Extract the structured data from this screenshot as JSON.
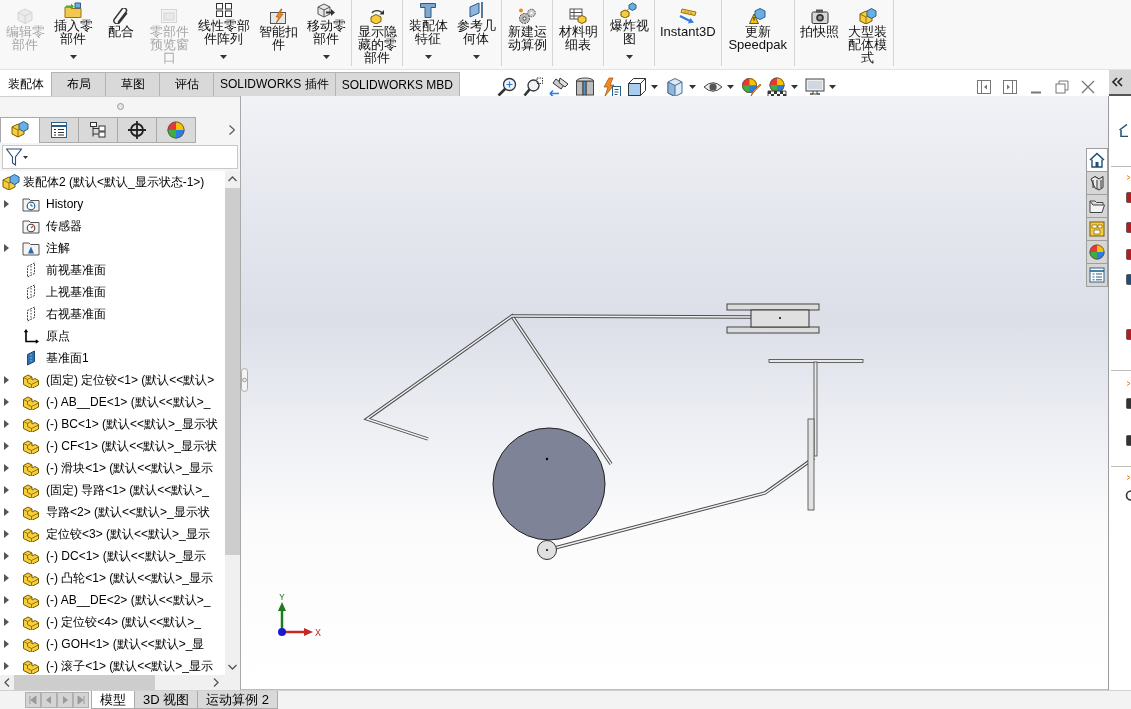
{
  "ribbon": {
    "groups": [
      {
        "buttons": [
          {
            "kind": "edit-component",
            "label": "编辑零部件",
            "disabled": true,
            "dropdown": false
          },
          {
            "kind": "insert-component",
            "label": "插入零部件",
            "disabled": false,
            "dropdown": true
          },
          {
            "kind": "mate",
            "label": "配合",
            "disabled": false,
            "dropdown": false
          },
          {
            "kind": "preview-window",
            "label": "零部件预览窗口",
            "disabled": true,
            "dropdown": false
          },
          {
            "kind": "linear-pattern",
            "label": "线性零部件阵列",
            "disabled": false,
            "dropdown": true
          },
          {
            "kind": "smart-fasteners",
            "label": "智能扣件",
            "disabled": false,
            "dropdown": false
          },
          {
            "kind": "move-component",
            "label": "移动零部件",
            "disabled": false,
            "dropdown": true
          }
        ]
      },
      {
        "buttons": [
          {
            "kind": "show-hidden",
            "label": "显示隐藏的零部件",
            "disabled": false,
            "dropdown": false
          }
        ]
      },
      {
        "buttons": [
          {
            "kind": "assembly-features",
            "label": "装配体特征",
            "disabled": false,
            "dropdown": true
          },
          {
            "kind": "reference-geometry",
            "label": "参考几何体",
            "disabled": false,
            "dropdown": true
          }
        ]
      },
      {
        "buttons": [
          {
            "kind": "motion-study",
            "label": "新建运动算例",
            "disabled": false,
            "dropdown": false
          }
        ]
      },
      {
        "buttons": [
          {
            "kind": "bom",
            "label": "材料明细表",
            "disabled": false,
            "dropdown": false
          }
        ]
      },
      {
        "buttons": [
          {
            "kind": "exploded-view",
            "label": "爆炸视图",
            "disabled": false,
            "dropdown": true
          }
        ]
      },
      {
        "buttons": [
          {
            "kind": "instant3d",
            "label": "Instant3D",
            "disabled": false,
            "dropdown": false
          }
        ]
      },
      {
        "buttons": [
          {
            "kind": "speedpak",
            "label": "更新Speedpak",
            "disabled": false,
            "dropdown": false
          }
        ]
      },
      {
        "buttons": [
          {
            "kind": "snapshot",
            "label": "拍快照",
            "disabled": false,
            "dropdown": false
          },
          {
            "kind": "large-assembly",
            "label": "大型装配体模式",
            "disabled": false,
            "dropdown": false
          }
        ]
      }
    ]
  },
  "command_tabs": [
    {
      "label": "装配体",
      "selected": true
    },
    {
      "label": "布局",
      "selected": false
    },
    {
      "label": "草图",
      "selected": false
    },
    {
      "label": "评估",
      "selected": false
    },
    {
      "label": "SOLIDWORKS 插件",
      "selected": false
    },
    {
      "label": "SOLIDWORKS MBD",
      "selected": false
    }
  ],
  "view_toolbar": [
    {
      "kind": "zoom-to-fit",
      "dropdown": false
    },
    {
      "kind": "zoom-to-area",
      "dropdown": false
    },
    {
      "kind": "previous-view",
      "dropdown": false
    },
    {
      "kind": "section-view",
      "dropdown": false
    },
    {
      "kind": "dynamic-annotation",
      "dropdown": false
    },
    {
      "kind": "view-orientation",
      "dropdown": true
    },
    {
      "kind": "display-style",
      "dropdown": true
    },
    {
      "kind": "hide-show",
      "dropdown": true
    },
    {
      "kind": "edit-appearance",
      "dropdown": false
    },
    {
      "kind": "apply-scene",
      "dropdown": true
    },
    {
      "kind": "view-settings",
      "dropdown": true
    }
  ],
  "feature_manager": {
    "panel_tabs": [
      {
        "kind": "feature-tree",
        "selected": true
      },
      {
        "kind": "property-manager",
        "selected": false
      },
      {
        "kind": "configuration-manager",
        "selected": false
      },
      {
        "kind": "dimxpert",
        "selected": false
      },
      {
        "kind": "display-manager",
        "selected": false
      }
    ],
    "tree": {
      "kind": "assembly",
      "label": "装配体2 (默认<默认_显示状态-1>)",
      "children": [
        {
          "kind": "history",
          "label": "History",
          "expandable": true
        },
        {
          "kind": "sensors",
          "label": "传感器",
          "expandable": false
        },
        {
          "kind": "annotations",
          "label": "注解",
          "expandable": true
        },
        {
          "kind": "plane",
          "label": "前视基准面",
          "expandable": false
        },
        {
          "kind": "plane",
          "label": "上视基准面",
          "expandable": false
        },
        {
          "kind": "plane",
          "label": "右视基准面",
          "expandable": false
        },
        {
          "kind": "origin",
          "label": "原点",
          "expandable": false
        },
        {
          "kind": "datum-plane",
          "label": "基准面1",
          "expandable": false
        },
        {
          "kind": "part",
          "label": "(固定) 定位铰<1> (默认<<默认>",
          "expandable": true
        },
        {
          "kind": "part",
          "label": "(-) AB__DE<1> (默认<<默认>_",
          "expandable": true
        },
        {
          "kind": "part",
          "label": "(-) BC<1> (默认<<默认>_显示状",
          "expandable": true
        },
        {
          "kind": "part",
          "label": "(-) CF<1> (默认<<默认>_显示状",
          "expandable": true
        },
        {
          "kind": "part",
          "label": "(-) 滑块<1> (默认<<默认>_显示",
          "expandable": true
        },
        {
          "kind": "part",
          "label": "(固定) 导路<1> (默认<<默认>_",
          "expandable": true
        },
        {
          "kind": "part",
          "label": "导路<2> (默认<<默认>_显示状",
          "expandable": true
        },
        {
          "kind": "part",
          "label": "定位铰<3> (默认<<默认>_显示",
          "expandable": true
        },
        {
          "kind": "part",
          "label": "(-) DC<1> (默认<<默认>_显示",
          "expandable": true
        },
        {
          "kind": "part",
          "label": "(-) 凸轮<1> (默认<<默认>_显示",
          "expandable": true
        },
        {
          "kind": "part",
          "label": "(-) AB__DE<2> (默认<<默认>_",
          "expandable": true
        },
        {
          "kind": "part",
          "label": "(-) 定位铰<4> (默认<<默认>_",
          "expandable": true
        },
        {
          "kind": "part",
          "label": "(-) GOH<1> (默认<<默认>_显",
          "expandable": true
        },
        {
          "kind": "part",
          "label": "(-) 滚子<1> (默认<<默认>_显示",
          "expandable": true
        }
      ]
    }
  },
  "canvas": {
    "triad": {
      "x_label": "X",
      "y_label": "Y"
    }
  },
  "task_pane": {
    "tabs": [
      {
        "kind": "home",
        "selected": true
      },
      {
        "kind": "design-library",
        "selected": false
      },
      {
        "kind": "file-explorer",
        "selected": false
      },
      {
        "kind": "view-palette",
        "selected": false
      },
      {
        "kind": "appearances",
        "selected": false
      },
      {
        "kind": "custom-properties",
        "selected": false
      }
    ]
  },
  "bottom_tabs": [
    {
      "label": "模型",
      "selected": true
    },
    {
      "label": "3D 视图",
      "selected": false
    },
    {
      "label": "运动算例 2",
      "selected": false
    }
  ]
}
